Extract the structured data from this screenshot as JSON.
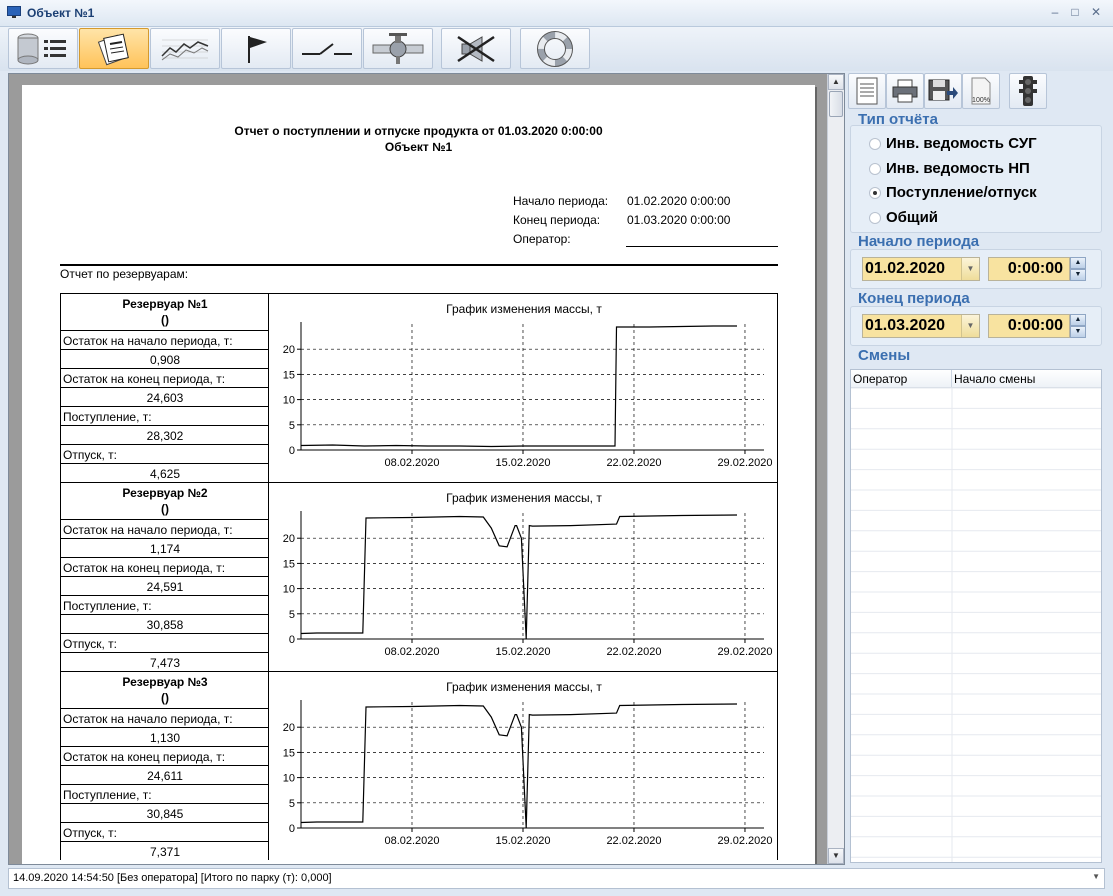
{
  "window": {
    "title": "Объект №1"
  },
  "toolbar": {
    "buttons": [
      {
        "icon": "tanks-list-icon"
      },
      {
        "icon": "report-icon",
        "active": true
      },
      {
        "icon": "trend-chart-icon"
      },
      {
        "icon": "flag-icon"
      },
      {
        "icon": "switch-icon"
      },
      {
        "icon": "valve-icon"
      },
      {
        "icon": "mute-alarm-icon"
      },
      {
        "icon": "lifebuoy-icon"
      }
    ]
  },
  "report": {
    "title": "Отчет о поступлении и отпуске продукта от 01.03.2020 0:00:00",
    "object": "Объект №1",
    "period_start_label": "Начало периода:",
    "period_start_value": "01.02.2020 0:00:00",
    "period_end_label": "Конец периода:",
    "period_end_value": "01.03.2020 0:00:00",
    "operator_label": "Оператор:",
    "section_label": "Отчет по резервуарам:",
    "labels": {
      "start_rest": "Остаток на начало периода, т:",
      "end_rest": "Остаток на конец периода, т:",
      "income": "Поступление, т:",
      "outcome": "Отпуск, т:",
      "chart_title": "График изменения массы, т"
    },
    "tanks": [
      {
        "name": "Резервуар №1",
        "sub": "()",
        "start_rest": "0,908",
        "end_rest": "24,603",
        "income": "28,302",
        "outcome": "4,625"
      },
      {
        "name": "Резервуар №2",
        "sub": "()",
        "start_rest": "1,174",
        "end_rest": "24,591",
        "income": "30,858",
        "outcome": "7,473"
      },
      {
        "name": "Резервуар №3",
        "sub": "()",
        "start_rest": "1,130",
        "end_rest": "24,611",
        "income": "30,845",
        "outcome": "7,371"
      }
    ]
  },
  "chart_data": [
    {
      "type": "line",
      "title": "График изменения массы, т",
      "x_ticks": [
        "08.02.2020",
        "15.02.2020",
        "22.02.2020",
        "29.02.2020"
      ],
      "y_ticks": [
        0,
        5,
        10,
        15,
        20
      ],
      "xlim": [
        "01.02.2020",
        "01.03.2020"
      ],
      "ylim": [
        0,
        25
      ],
      "grid": true,
      "series": [
        {
          "x": [
            1,
            3,
            5,
            7,
            9,
            11,
            13,
            15,
            17,
            19,
            20.8,
            20.9,
            23,
            25,
            27,
            28.5
          ],
          "y": [
            0.9,
            1.0,
            0.8,
            0.9,
            0.8,
            0.8,
            0.7,
            0.8,
            0.8,
            0.8,
            0.8,
            24.4,
            24.4,
            24.5,
            24.6,
            24.6
          ]
        }
      ]
    },
    {
      "type": "line",
      "title": "График изменения массы, т",
      "x_ticks": [
        "08.02.2020",
        "15.02.2020",
        "22.02.2020",
        "29.02.2020"
      ],
      "y_ticks": [
        0,
        5,
        10,
        15,
        20
      ],
      "xlim": [
        "01.02.2020",
        "01.03.2020"
      ],
      "ylim": [
        0,
        25
      ],
      "grid": true,
      "series": [
        {
          "x": [
            1,
            2,
            4.9,
            5.1,
            8,
            11,
            12.5,
            13,
            13.5,
            14,
            14.5,
            14.6,
            14.9,
            15.2,
            15.4,
            15.6,
            18,
            20.9,
            21.1,
            25,
            28.5
          ],
          "y": [
            1.1,
            1.2,
            1.2,
            24.0,
            24.1,
            24.3,
            24.2,
            22.0,
            18.5,
            18.3,
            22.5,
            22.5,
            20.0,
            0.0,
            22.5,
            22.4,
            22.5,
            22.8,
            24.3,
            24.5,
            24.6
          ]
        }
      ]
    },
    {
      "type": "line",
      "title": "График изменения массы, т",
      "x_ticks": [
        "08.02.2020",
        "15.02.2020",
        "22.02.2020",
        "29.02.2020"
      ],
      "y_ticks": [
        0,
        5,
        10,
        15,
        20
      ],
      "xlim": [
        "01.02.2020",
        "01.03.2020"
      ],
      "ylim": [
        0,
        25
      ],
      "grid": true,
      "series": [
        {
          "x": [
            1,
            2,
            4.9,
            5.1,
            8,
            11,
            12.5,
            13,
            13.5,
            14,
            14.5,
            14.6,
            14.9,
            15.2,
            15.4,
            15.6,
            18,
            20.9,
            21.1,
            25,
            28.5
          ],
          "y": [
            1.1,
            1.2,
            1.2,
            24.0,
            24.1,
            24.3,
            24.2,
            22.0,
            18.5,
            18.3,
            22.5,
            22.5,
            20.0,
            0.0,
            22.5,
            22.4,
            22.5,
            22.8,
            24.3,
            24.5,
            24.6
          ]
        }
      ]
    }
  ],
  "right_panel": {
    "tools": [
      {
        "icon": "page-setup-icon"
      },
      {
        "icon": "print-icon"
      },
      {
        "icon": "export-icon"
      },
      {
        "icon": "zoom-100-icon",
        "text": "100%"
      },
      {
        "icon": "traffic-light-icon"
      }
    ],
    "report_type_title": "Тип отчёта",
    "report_types": [
      {
        "label": "Инв. ведомость СУГ",
        "selected": false
      },
      {
        "label": "Инв. ведомость НП",
        "selected": false
      },
      {
        "label": "Поступление/отпуск",
        "selected": true
      },
      {
        "label": "Общий",
        "selected": false
      }
    ],
    "start_title": "Начало периода",
    "start_date": "01.02.2020",
    "start_time": "0:00:00",
    "end_title": "Конец периода",
    "end_date": "01.03.2020",
    "end_time": "0:00:00",
    "shifts_title": "Смены",
    "shifts_columns": [
      "Оператор",
      "Начало смены"
    ]
  },
  "status": {
    "text": "14.09.2020 14:54:50 [Без оператора] [Итого по парку  (т): 0,000]"
  }
}
